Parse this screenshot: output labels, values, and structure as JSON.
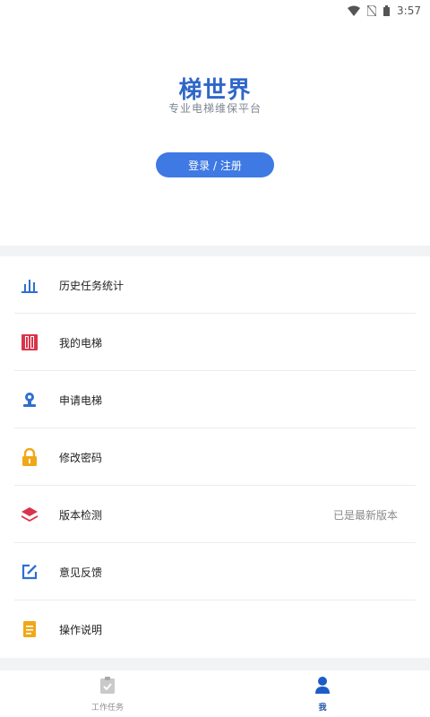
{
  "status_bar": {
    "time": "3:57"
  },
  "header": {
    "brand": "梯世界",
    "slogan": "专业电梯维保平台",
    "login_label": "登录 / 注册"
  },
  "menu": {
    "items": [
      {
        "label": "历史任务统计",
        "icon": "bar-chart-icon"
      },
      {
        "label": "我的电梯",
        "icon": "elevator-icon"
      },
      {
        "label": "申请电梯",
        "icon": "user-stamp-icon"
      },
      {
        "label": "修改密码",
        "icon": "lock-icon"
      },
      {
        "label": "版本检测",
        "icon": "layers-icon",
        "extra": "已是最新版本"
      },
      {
        "label": "意见反馈",
        "icon": "edit-icon"
      },
      {
        "label": "操作说明",
        "icon": "document-icon"
      }
    ]
  },
  "tabbar": {
    "tabs": [
      {
        "label": "工作任务",
        "icon": "clipboard-icon"
      },
      {
        "label": "我",
        "icon": "person-icon"
      }
    ]
  },
  "colors": {
    "brand": "#2f67c7",
    "login_button": "#3f79e3",
    "icon_blue": "#2f6fd1",
    "icon_red": "#d9344b",
    "icon_orange": "#f0a818",
    "tab_active": "#1c4ea8"
  }
}
